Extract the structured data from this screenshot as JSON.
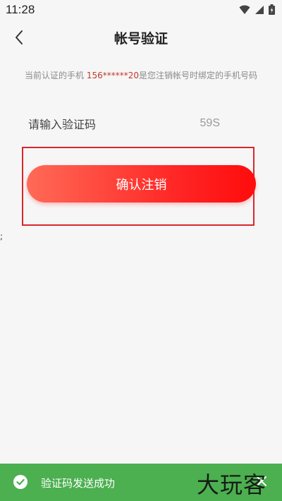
{
  "status_bar": {
    "time": "11:28",
    "icons": [
      "wifi-icon",
      "signal-icon",
      "battery-icon"
    ]
  },
  "header": {
    "title": "帐号验证",
    "back_icon": "chevron-left-icon"
  },
  "notice": {
    "prefix": "当前认证的手机 ",
    "phone": "156******20",
    "suffix": "是您注销帐号时绑定的手机号码",
    "phone_color": "#c0392b"
  },
  "code_field": {
    "placeholder": "请输入验证码",
    "value": "",
    "countdown": "59S"
  },
  "confirm_button": {
    "label": "确认注销",
    "gradient_start": "#ff6a57",
    "gradient_end": "#ff0c0c"
  },
  "stray_mark": ";",
  "toast": {
    "message": "验证码发送成功",
    "background": "#4caf50",
    "check_icon": "check-circle-icon",
    "close_icon": "close-icon"
  },
  "watermark": {
    "text": "大玩客"
  }
}
